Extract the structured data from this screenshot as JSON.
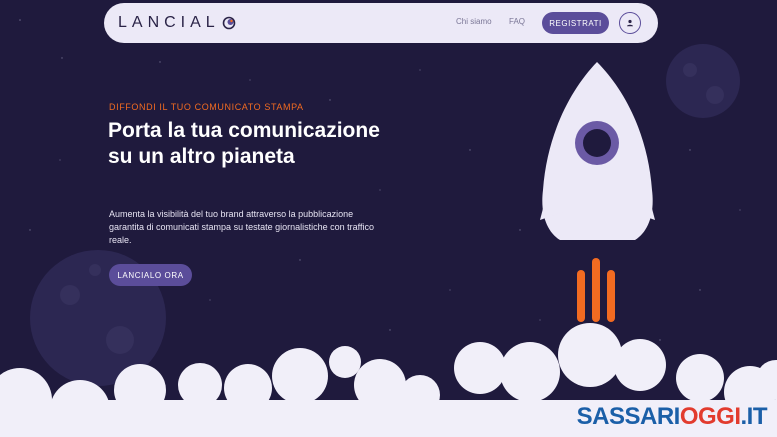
{
  "brand": {
    "logo_text": "LANCIAL",
    "logo_mark": "planet-o-logo-icon"
  },
  "nav": {
    "links": [
      "Chi siamo",
      "FAQ"
    ],
    "register_label": "REGISTRATI",
    "user_icon": "user-icon"
  },
  "hero": {
    "kicker": "DIFFONDI IL TUO COMUNICATO STAMPA",
    "headline": "Porta la tua comunicazione su un altro pianeta",
    "subtext": "Aumenta la visibilità del tuo brand attraverso la pubblicazione garantita di comunicati stampa su testate giornalistiche con traffico reale.",
    "cta_label": "LANCIALO ORA"
  },
  "watermark": {
    "part1": "SASSARI",
    "part2": "OGGI",
    "part3": ".IT"
  },
  "colors": {
    "background": "#1f1a3d",
    "accent": "#5b4d9a",
    "orange": "#f26b21",
    "cloud": "#f1eff9"
  }
}
